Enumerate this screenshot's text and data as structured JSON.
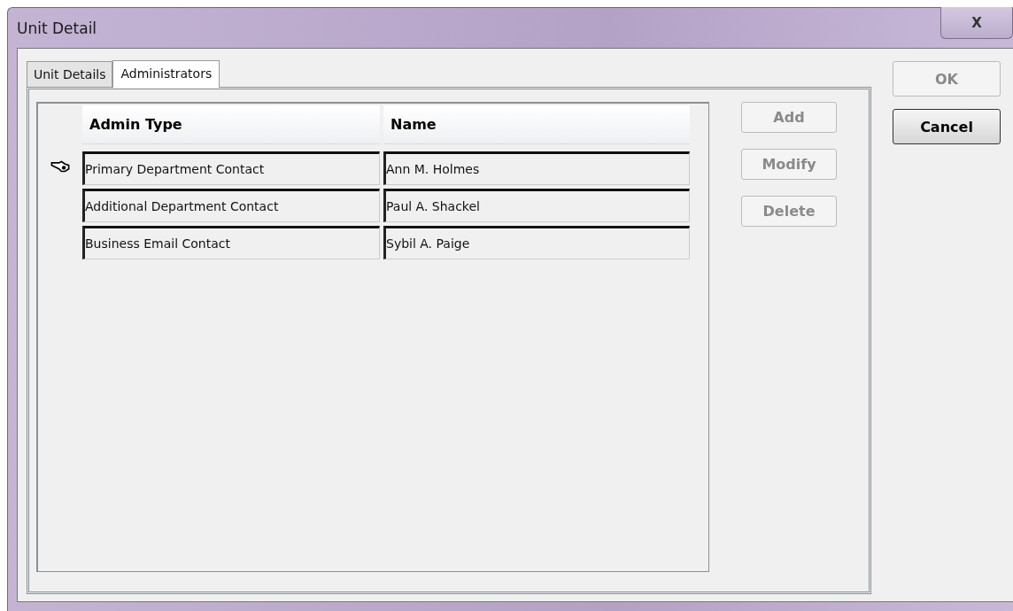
{
  "window": {
    "title": "Unit Detail",
    "close": "X"
  },
  "tabs": [
    {
      "label": "Unit Details",
      "selected": false
    },
    {
      "label": "Administrators",
      "selected": true
    }
  ],
  "table": {
    "columns": [
      "Admin Type",
      "Name"
    ],
    "rows": [
      {
        "cells": [
          "Primary Department Contact",
          "Ann M. Holmes"
        ],
        "selected": true
      },
      {
        "cells": [
          "Additional Department Contact",
          "Paul A. Shackel"
        ],
        "selected": false
      },
      {
        "cells": [
          "Business Email Contact",
          "Sybil A. Paige"
        ],
        "selected": false
      }
    ]
  },
  "grid_buttons": [
    {
      "label": "Add",
      "disabled": true
    },
    {
      "label": "Modify",
      "disabled": true
    },
    {
      "label": "Delete",
      "disabled": true
    }
  ],
  "dialog_buttons": [
    {
      "label": "OK",
      "disabled": true
    },
    {
      "label": "Cancel",
      "disabled": false
    }
  ]
}
